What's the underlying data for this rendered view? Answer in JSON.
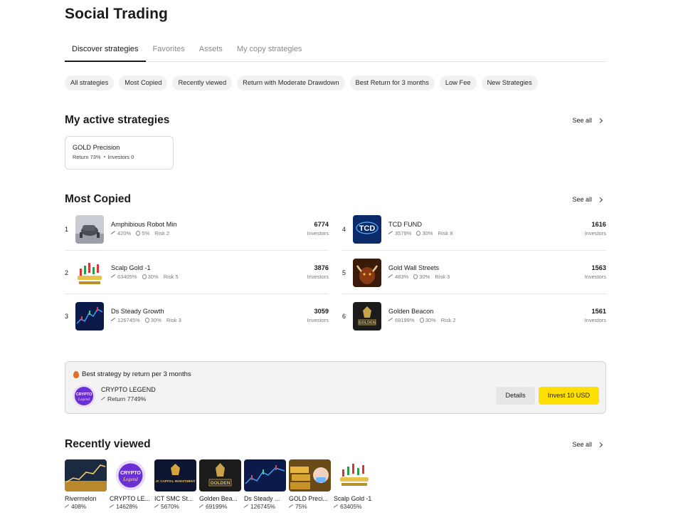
{
  "page": {
    "title": "Social Trading"
  },
  "tabs": [
    "Discover strategies",
    "Favorites",
    "Assets",
    "My copy strategies"
  ],
  "filters": [
    "All strategies",
    "Most Copied",
    "Recently viewed",
    "Return with Moderate Drawdown",
    "Best Return for 3 months",
    "Low Fee",
    "New Strategies"
  ],
  "active_strategies": {
    "title": "My active strategies",
    "see_all": "See all",
    "items": [
      {
        "name": "GOLD Precision",
        "return_text": "Return 73%",
        "investors_text": "Investors 0"
      }
    ]
  },
  "most_copied": {
    "title": "Most Copied",
    "see_all": "See all",
    "items": [
      {
        "rank": "1",
        "name": "Amphibious Robot Min",
        "return": "420%",
        "fee": "5%",
        "risk": "Risk 2",
        "investors": "6774",
        "investors_label": "Investors",
        "thumb_icon": "robot-thumbnail"
      },
      {
        "rank": "2",
        "name": "Scalp Gold -1",
        "return": "63405%",
        "fee": "30%",
        "risk": "Risk 5",
        "investors": "3876",
        "investors_label": "Investors",
        "thumb_icon": "candles-thumbnail"
      },
      {
        "rank": "3",
        "name": "Ds Steady Growth",
        "return": "126745%",
        "fee": "30%",
        "risk": "Risk 3",
        "investors": "3059",
        "investors_label": "Investors",
        "thumb_icon": "chart-thumbnail"
      },
      {
        "rank": "4",
        "name": "TCD FUND",
        "return": "3579%",
        "fee": "30%",
        "risk": "Risk 8",
        "investors": "1616",
        "investors_label": "Investors",
        "thumb_icon": "tcd-logo-thumbnail"
      },
      {
        "rank": "5",
        "name": "Gold Wall Streets",
        "return": "483%",
        "fee": "30%",
        "risk": "Risk 3",
        "investors": "1563",
        "investors_label": "Investors",
        "thumb_icon": "bull-thumbnail"
      },
      {
        "rank": "6",
        "name": "Golden Beacon",
        "return": "69199%",
        "fee": "30%",
        "risk": "Risk 2",
        "investors": "1561",
        "investors_label": "Investors",
        "thumb_icon": "golden-logo-thumbnail"
      }
    ]
  },
  "best_strategy": {
    "title": "Best strategy by return per 3 months",
    "name": "CRYPTO LEGEND",
    "return_text": "Return 7749%",
    "details_label": "Details",
    "invest_label": "Invest 10 USD",
    "accent": "#ffdf00"
  },
  "recently_viewed": {
    "title": "Recently viewed",
    "see_all": "See all",
    "items": [
      {
        "name": "Rivermelon",
        "return": "408%"
      },
      {
        "name": "CRYPTO LE...",
        "return": "14628%"
      },
      {
        "name": "ICT SMC St...",
        "return": "5670%"
      },
      {
        "name": "Golden Bea...",
        "return": "69199%"
      },
      {
        "name": "Ds Steady ...",
        "return": "126745%"
      },
      {
        "name": "GOLD Preci...",
        "return": "75%"
      },
      {
        "name": "Scalp Gold -1",
        "return": "63405%"
      }
    ]
  },
  "thumb_text": {
    "tcd": "TCD",
    "golden": "GOLDEN",
    "ict": "JC CAPITAL INVESTMENT",
    "crypto_line1": "CRYPTO",
    "crypto_line2": "Legend"
  }
}
